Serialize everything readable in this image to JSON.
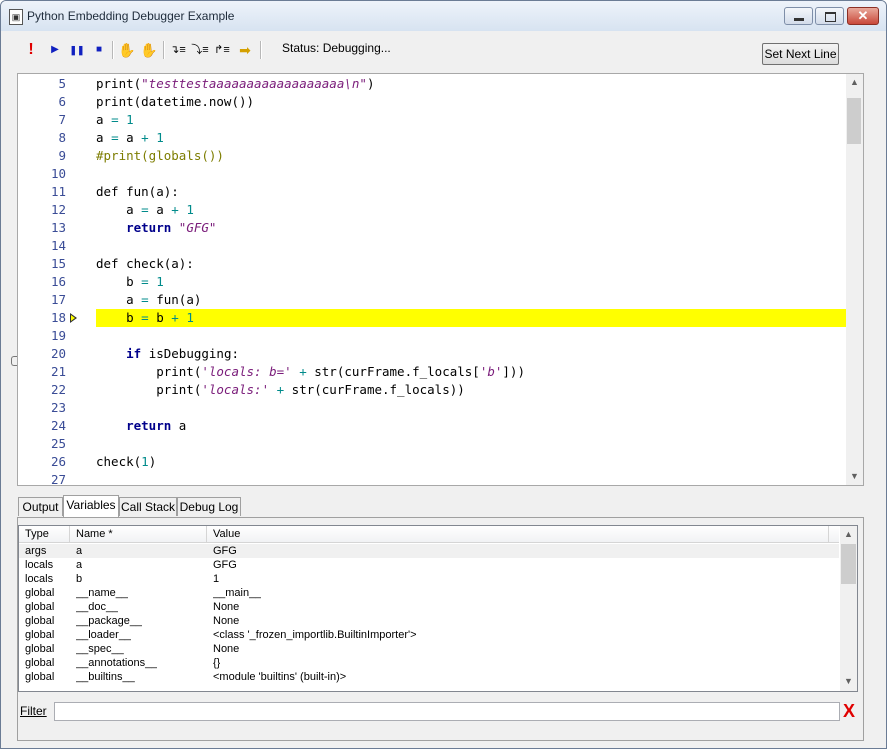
{
  "window": {
    "title": "Python Embedding Debugger Example"
  },
  "toolbar": {
    "status": "Status: Debugging...",
    "set_next_line_label": "Set Next Line",
    "icons": [
      "stop-icon",
      "run-icon",
      "pause-icon",
      "stop-square-icon",
      "hand-breakpoint-icon",
      "clear-breakpoints-icon",
      "step-into-icon",
      "step-over-icon",
      "step-out-icon",
      "show-next-statement-icon"
    ]
  },
  "editor": {
    "current_line": 18,
    "line_numbers": [
      "5",
      "6",
      "7",
      "8",
      "9",
      "10",
      "11",
      "12",
      "13",
      "14",
      "15",
      "16",
      "17",
      "18",
      "19",
      "20",
      "21",
      "22",
      "23",
      "24",
      "25",
      "26",
      "27"
    ]
  },
  "tabs": [
    {
      "label": "Output",
      "active": false
    },
    {
      "label": "Variables",
      "active": true
    },
    {
      "label": "Call Stack",
      "active": false
    },
    {
      "label": "Debug Log",
      "active": false
    }
  ],
  "variables": {
    "columns": [
      "Type",
      "Name *",
      "Value"
    ],
    "rows": [
      {
        "type": "args",
        "name": "a",
        "value": "GFG"
      },
      {
        "type": "locals",
        "name": "a",
        "value": "GFG"
      },
      {
        "type": "locals",
        "name": "b",
        "value": "1"
      },
      {
        "type": "global",
        "name": "__name__",
        "value": "__main__"
      },
      {
        "type": "global",
        "name": "__doc__",
        "value": "None"
      },
      {
        "type": "global",
        "name": "__package__",
        "value": "None"
      },
      {
        "type": "global",
        "name": "__loader__",
        "value": "<class '_frozen_importlib.BuiltinImporter'>"
      },
      {
        "type": "global",
        "name": "__spec__",
        "value": "None"
      },
      {
        "type": "global",
        "name": "__annotations__",
        "value": "{}"
      },
      {
        "type": "global",
        "name": "__builtins__",
        "value": "<module 'builtins' (built-in)>"
      }
    ]
  },
  "filter": {
    "label": "Filter",
    "value": ""
  },
  "colors": {
    "current_line_highlight": "#ffff00",
    "keyword": "#00008b",
    "string": "#7a1c7a",
    "comment": "#7d7d00",
    "line_number": "#3a4c96",
    "clear_filter": "#e00000"
  }
}
